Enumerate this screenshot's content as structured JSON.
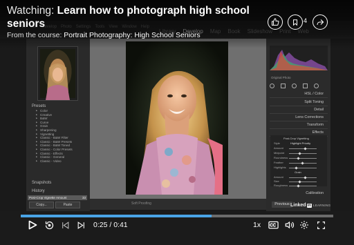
{
  "header": {
    "watching_prefix": "Watching:",
    "title": "Learn how to photograph high school seniors",
    "course_prefix": "From the course:",
    "course_name": "Portrait Photography: High School Seniors",
    "save_count": "4"
  },
  "video_content": {
    "modules": [
      "Library",
      "Develop",
      "Map",
      "Book",
      "Slideshow",
      "Print",
      "Web"
    ],
    "active_module": "Develop",
    "menu": [
      "File",
      "Edit",
      "Develop",
      "Photo",
      "Settings",
      "Tools",
      "View",
      "Window",
      "Help"
    ],
    "left_panel": {
      "presets_title": "Presets",
      "presets": [
        "Color",
        "Creative",
        "B&W",
        "Curve",
        "Grain",
        "Sharpening",
        "Vignetting",
        "Classic - B&W Filter",
        "Classic - B&W Presets",
        "Classic - B&W Toned",
        "Classic - Color Presets",
        "Classic - Effects",
        "Classic - General",
        "Classic - Video"
      ],
      "snapshots_title": "Snapshots",
      "history_title": "History",
      "history_item": "Post-Crop Vignette Amount",
      "history_value": "33",
      "copy_label": "Copy...",
      "paste_label": "Paste"
    },
    "right_panel": {
      "original_photo": "Original Photo",
      "sections": [
        "HSL / Color",
        "Split Toning",
        "Detail",
        "Lens Corrections",
        "Transform",
        "Effects"
      ],
      "effects_subtitle": "Post-Crop Vignetting",
      "style_label": "Style",
      "style_value": "Highlight Priority",
      "sliders": [
        "Amount",
        "Midpoint",
        "Roundness",
        "Feather",
        "Highlights"
      ],
      "grain_title": "Grain",
      "grain_sliders": [
        "Amount",
        "Size",
        "Roughness"
      ],
      "calibration": "Calibration",
      "previous_label": "Previous"
    },
    "toolbar_text": "Soft Proofing",
    "watermark": {
      "brand": "Linked",
      "in": "in",
      "suffix": "LEARNING"
    }
  },
  "player": {
    "current_time": "0:25",
    "duration": "0:41",
    "time_separator": " / ",
    "speed": "1x",
    "progress": 0.61
  },
  "colors": {
    "accent": "#4aa4e7",
    "player_bg": "#1b1b1b"
  },
  "icons": [
    "thumbs-up-icon",
    "bookmark-icon",
    "share-icon",
    "play-icon",
    "replay-icon",
    "previous-icon",
    "next-icon",
    "captions-icon",
    "volume-icon",
    "settings-icon",
    "fullscreen-icon"
  ]
}
